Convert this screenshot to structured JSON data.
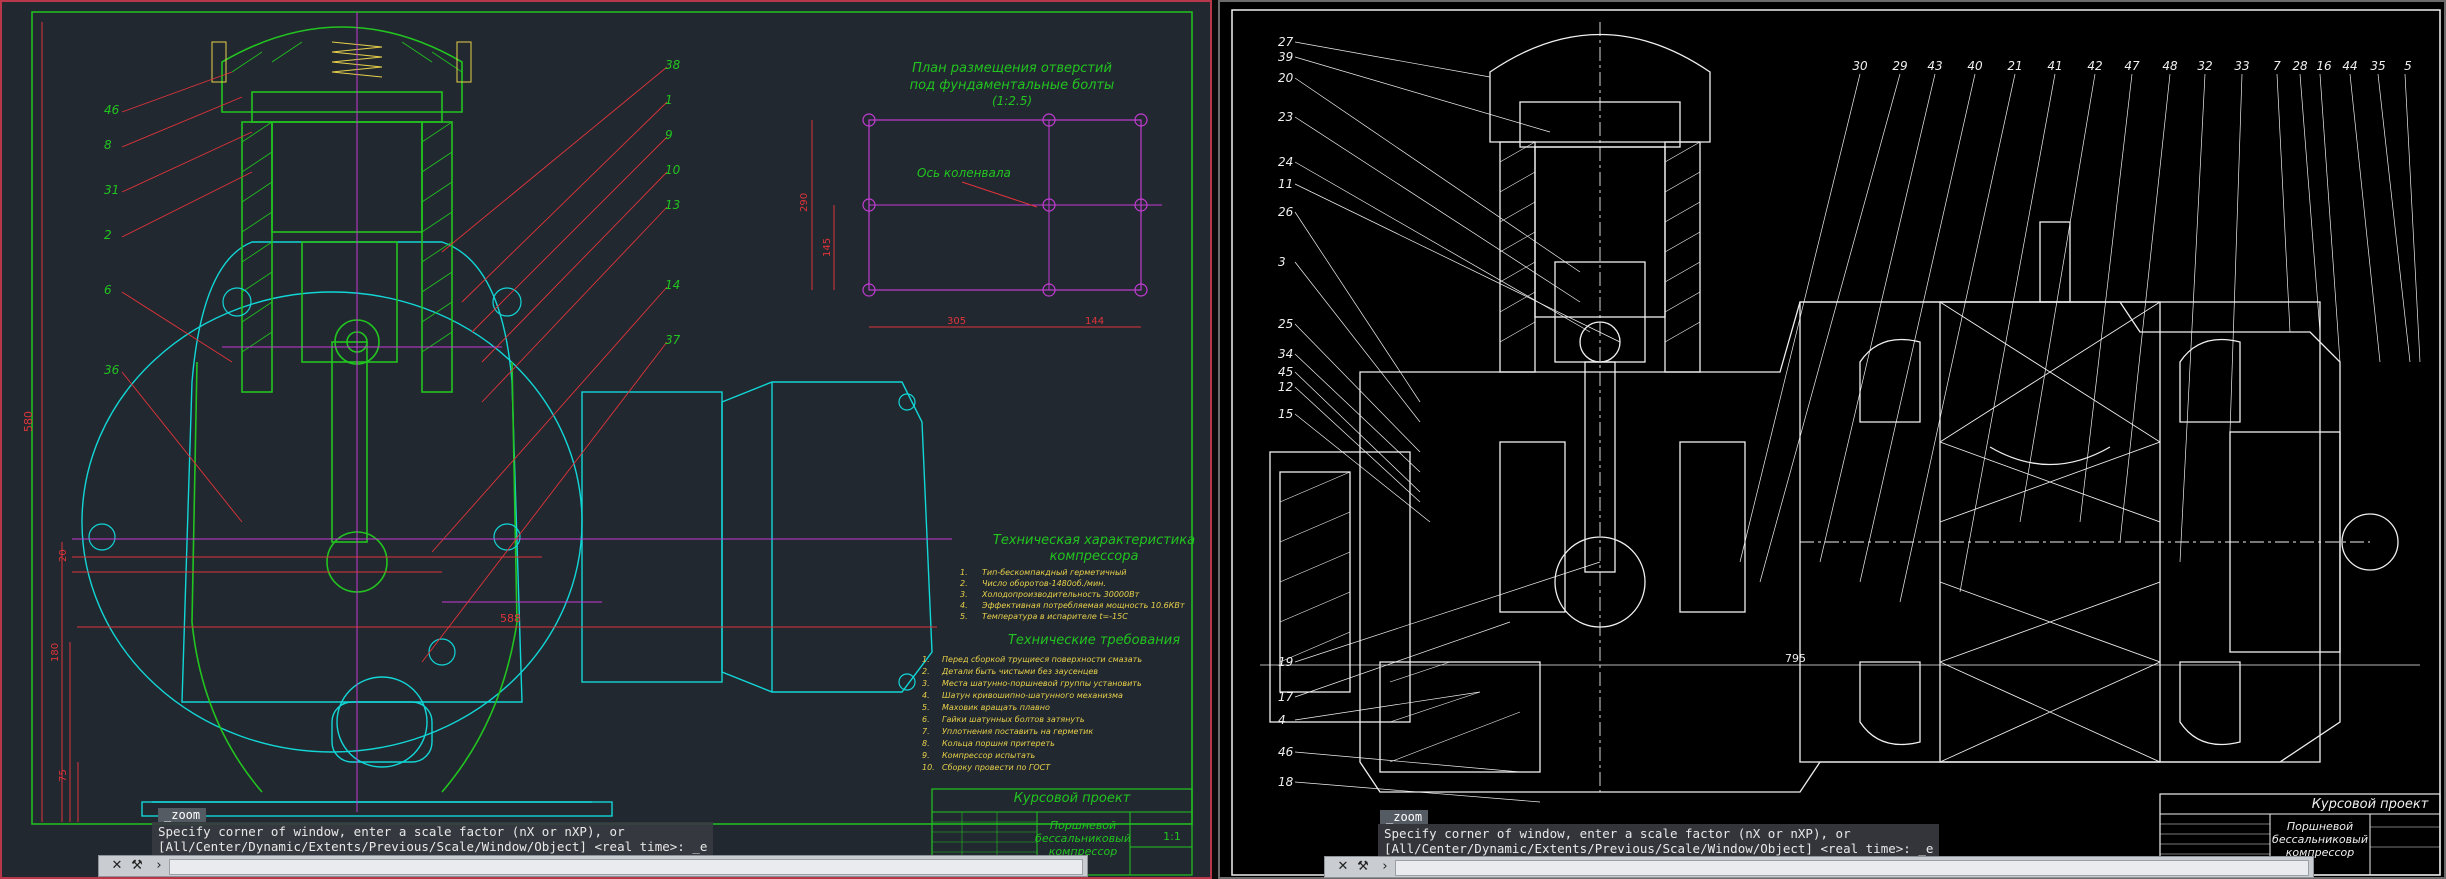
{
  "left_drawing": {
    "title_plan_1": "План размещения отверстий",
    "title_plan_2": "под фундаментальные болты",
    "title_plan_3": "(1:2.5)",
    "axis_label": "Ось коленвала",
    "tech_char_1": "Техническая характеристика",
    "tech_char_2": "компрессора",
    "tech_items": [
      "Тип-бескомпакдный герметичный",
      "Число оборотов-1480об./мин.",
      "Холодопроизводительность 30000Вт",
      "Эффективная потребляемая мощность 10.6КВт",
      "Температура в испарителе t=-15С"
    ],
    "tech_req_title": "Технические требования",
    "tech_req_items": [
      "Перед сборкой трущиеся поверхности смазать",
      "Детали быть чистыми без заусенцев",
      "Места шатунно-поршневой группы установить",
      "Шатун кривошипно-шатунного механизма",
      "Маховик вращать плавно",
      "Гайки шатунных болтов затянуть",
      "Уплотнения поставить на герметик",
      "Кольца поршня притереть",
      "Компрессор испытать",
      "Сборку провести по ГОСТ"
    ],
    "project_label": "Курсовой проект",
    "title_block_name_1": "Поршневой",
    "title_block_name_2": "бессальниковый",
    "title_block_name_3": "компрессор",
    "scale": "1:1",
    "dim_290": "290",
    "dim_145": "145",
    "dim_305": "305",
    "dim_144": "144",
    "dim_588": "588",
    "dim_580": "580",
    "dim_180": "180",
    "dim_75": "75",
    "dim_20": "20",
    "callouts": [
      "46",
      "8",
      "31",
      "2",
      "6",
      "36",
      "38",
      "1",
      "9",
      "10",
      "13",
      "14",
      "37"
    ]
  },
  "right_drawing": {
    "project_label": "Курсовой проект",
    "title_block_name_1": "Поршневой",
    "title_block_name_2": "бессальниковый",
    "title_block_name_3": "компрессор",
    "dim_795": "795",
    "callouts_left": [
      "27",
      "39",
      "20",
      "23",
      "24",
      "11",
      "26",
      "3",
      "25",
      "34",
      "45",
      "12",
      "15",
      "19",
      "17",
      "4",
      "46",
      "18"
    ],
    "callouts_top": [
      "30",
      "29",
      "43",
      "40",
      "21",
      "41",
      "42",
      "47",
      "48",
      "32",
      "33",
      "7",
      "28",
      "16",
      "44",
      "35",
      "5"
    ]
  },
  "command_line": {
    "zoom_tag": "_zoom",
    "line1": "Specify corner of window, enter a scale factor (nX or nXP), or",
    "line2": "[All/Center/Dynamic/Extents/Previous/Scale/Window/Object] <real time>: _e",
    "close_icon": "close-icon",
    "wrench_icon": "wrench-icon",
    "prompt_icon": "prompt-icon"
  },
  "colors": {
    "green": "#22c41f",
    "cyan": "#12d6d6",
    "magenta": "#c23cd2",
    "red": "#e0343a",
    "yellow": "#e8d04a",
    "white": "#f0f0f0"
  }
}
